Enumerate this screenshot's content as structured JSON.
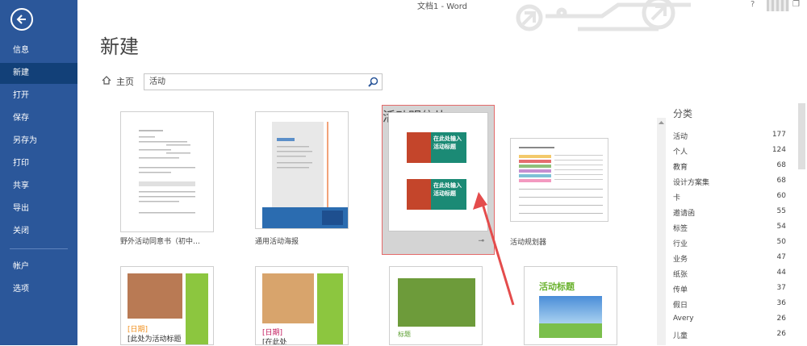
{
  "window": {
    "title": "文档1 - Word",
    "help": "?",
    "minimize": "–",
    "restore": "❐"
  },
  "sidebar": {
    "back_icon": "back-arrow-icon",
    "items": [
      {
        "label": "信息",
        "active": false
      },
      {
        "label": "新建",
        "active": true
      },
      {
        "label": "打开",
        "active": false
      },
      {
        "label": "保存",
        "active": false
      },
      {
        "label": "另存为",
        "active": false
      },
      {
        "label": "打印",
        "active": false
      },
      {
        "label": "共享",
        "active": false
      },
      {
        "label": "导出",
        "active": false
      },
      {
        "label": "关闭",
        "active": false
      },
      {
        "label": "帐户",
        "active": false
      },
      {
        "label": "选项",
        "active": false
      }
    ]
  },
  "main": {
    "title": "新建",
    "home_label": "主页",
    "search": {
      "value": "活动",
      "placeholder": ""
    }
  },
  "templates": [
    {
      "name": "野外活动同意书（初中…"
    },
    {
      "name": "通用活动海报"
    },
    {
      "name": "活动明信片",
      "pin_icon": "pin-icon",
      "thumb_text_1": "在此处输入活动标题",
      "thumb_text_2": "在此处输入活动标题"
    },
    {
      "name": "活动规划器"
    },
    {
      "name": "",
      "thumb_date": "[日期]",
      "thumb_text": "[此处为活动标题"
    },
    {
      "name": "",
      "thumb_date": "[日期]",
      "thumb_text": "[在此处"
    },
    {
      "name": "",
      "thumb_text": "标题"
    },
    {
      "name": "",
      "thumb_text": "活动标题"
    }
  ],
  "categories": {
    "header": "分类",
    "items": [
      {
        "label": "活动",
        "count": "177"
      },
      {
        "label": "个人",
        "count": "124"
      },
      {
        "label": "教育",
        "count": "68"
      },
      {
        "label": "设计方案集",
        "count": "68"
      },
      {
        "label": "卡",
        "count": "60"
      },
      {
        "label": "邀请函",
        "count": "55"
      },
      {
        "label": "标签",
        "count": "54"
      },
      {
        "label": "行业",
        "count": "50"
      },
      {
        "label": "业务",
        "count": "47"
      },
      {
        "label": "纸张",
        "count": "44"
      },
      {
        "label": "传单",
        "count": "37"
      },
      {
        "label": "假日",
        "count": "36"
      },
      {
        "label": "Avery",
        "count": "26"
      },
      {
        "label": "儿童",
        "count": "26"
      }
    ]
  },
  "colors": {
    "accent": "#2b579a",
    "highlight": "#e44c4c",
    "card_green": "#1b8a75"
  }
}
